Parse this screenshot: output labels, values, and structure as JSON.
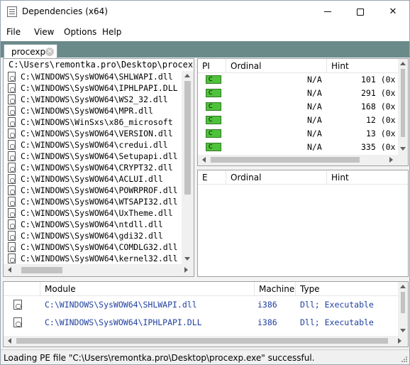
{
  "window": {
    "title": "Dependencies (x64)",
    "minimize_glyph": "",
    "close_glyph": "✕"
  },
  "menu": [
    "File",
    "View",
    "Options",
    "Help"
  ],
  "tab": {
    "label": "procexp",
    "close_glyph": "×"
  },
  "tree": {
    "root": "C:\\Users\\remontka.pro\\Desktop\\procexp.exe",
    "items": [
      "C:\\WINDOWS\\SysWOW64\\SHLWAPI.dll",
      "C:\\WINDOWS\\SysWOW64\\IPHLPAPI.DLL",
      "C:\\WINDOWS\\SysWOW64\\WS2_32.dll",
      "C:\\WINDOWS\\SysWOW64\\MPR.dll",
      "C:\\WINDOWS\\WinSxs\\x86_microsoft",
      "C:\\WINDOWS\\SysWOW64\\VERSION.dll",
      "C:\\WINDOWS\\SysWOW64\\credui.dll",
      "C:\\WINDOWS\\SysWOW64\\Setupapi.dll",
      "C:\\WINDOWS\\SysWOW64\\CRYPT32.dll",
      "C:\\WINDOWS\\SysWOW64\\ACLUI.dll",
      "C:\\WINDOWS\\SysWOW64\\POWRPROF.dll",
      "C:\\WINDOWS\\SysWOW64\\WTSAPI32.dll",
      "C:\\WINDOWS\\SysWOW64\\UxTheme.dll",
      "C:\\WINDOWS\\SysWOW64\\ntdll.dll",
      "C:\\WINDOWS\\SysWOW64\\gdi32.dll",
      "C:\\WINDOWS\\SysWOW64\\COMDLG32.dll",
      "C:\\WINDOWS\\SysWOW64\\kernel32.dll"
    ]
  },
  "imports": {
    "headers": [
      "PI",
      "Ordinal",
      "Hint"
    ],
    "icon_text": "C",
    "rows": [
      {
        "ordinal": "N/A",
        "hint": "101 (0x"
      },
      {
        "ordinal": "N/A",
        "hint": "291 (0x"
      },
      {
        "ordinal": "N/A",
        "hint": "168 (0x"
      },
      {
        "ordinal": "N/A",
        "hint": "12 (0x"
      },
      {
        "ordinal": "N/A",
        "hint": "13 (0x"
      },
      {
        "ordinal": "N/A",
        "hint": "335 (0x"
      }
    ]
  },
  "exports": {
    "headers": [
      "E",
      "Ordinal",
      "Hint"
    ]
  },
  "modules": {
    "headers": [
      "Module",
      "Machine",
      "Type"
    ],
    "rows": [
      {
        "module": "C:\\WINDOWS\\SysWOW64\\SHLWAPI.dll",
        "machine": "i386",
        "type": "Dll; Executable"
      },
      {
        "module": "C:\\WINDOWS\\SysWOW64\\IPHLPAPI.DLL",
        "machine": "i386",
        "type": "Dll; Executable"
      }
    ]
  },
  "status": "Loading PE file \"C:\\Users\\remontka.pro\\Desktop\\procexp.exe\" successful.",
  "colors": {
    "tab_strip": "#6a8a8a",
    "import_icon": "#4ec23a",
    "module_text": "#1f3f9f"
  }
}
